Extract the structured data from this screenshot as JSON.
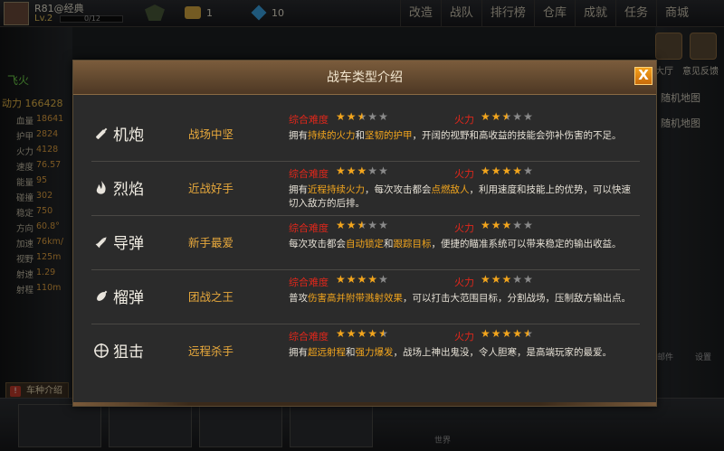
{
  "topbar": {
    "player_name": "R81@经典",
    "level": "Lv.2",
    "exp": "0/12",
    "gold": "1",
    "gems": "10",
    "menu": [
      "改造",
      "战队",
      "排行榜",
      "仓库",
      "成就",
      "任务",
      "商城"
    ]
  },
  "left_panel": {
    "car_name": "飞火",
    "power": "动力 166428",
    "stats": [
      {
        "name": "血量",
        "value": "18641"
      },
      {
        "name": "护甲",
        "value": "2824"
      },
      {
        "name": "火力",
        "value": "4128"
      },
      {
        "name": "速度",
        "value": "76.57"
      },
      {
        "name": "能量",
        "value": "95"
      },
      {
        "name": "碰撞",
        "value": "302"
      },
      {
        "name": "稳定",
        "value": "750"
      },
      {
        "name": "方向",
        "value": "60.8°"
      },
      {
        "name": "加速",
        "value": "76km/"
      },
      {
        "name": "视野",
        "value": "125m"
      },
      {
        "name": "射速",
        "value": "1.29"
      },
      {
        "name": "射程",
        "value": "110m"
      }
    ],
    "car_intro": "车种介绍"
  },
  "right_panel": {
    "lobby": "大厅",
    "feedback": "意见反馈",
    "map": "随机地图",
    "map2": "随机地图",
    "mail": "邮件",
    "settings": "设置"
  },
  "chat": {
    "world": "世界"
  },
  "dialog": {
    "title": "战车类型介绍",
    "close": "X",
    "difficulty_label": "综合难度",
    "firepower_label": "火力",
    "types": [
      {
        "icon": "machine-gun-icon",
        "name": "机炮",
        "tag": "战场中坚",
        "difficulty": 2.5,
        "firepower": 2.5,
        "desc": [
          {
            "t": "拥有",
            "h": false
          },
          {
            "t": "持续的火力",
            "h": true
          },
          {
            "t": "和",
            "h": false
          },
          {
            "t": "坚韧的护甲",
            "h": true
          },
          {
            "t": "，开阔的视野和高收益的技能会弥补伤害的不足。",
            "h": false
          }
        ]
      },
      {
        "icon": "flame-icon",
        "name": "烈焰",
        "tag": "近战好手",
        "difficulty": 3,
        "firepower": 4,
        "desc": [
          {
            "t": "拥有",
            "h": false
          },
          {
            "t": "近程持续火力",
            "h": true
          },
          {
            "t": "，每次攻击都会",
            "h": false
          },
          {
            "t": "点燃敌人",
            "h": true
          },
          {
            "t": "，利用速度和技能上的优势，可以快速切入敌方的后排。",
            "h": false
          }
        ]
      },
      {
        "icon": "missile-icon",
        "name": "导弹",
        "tag": "新手最爱",
        "difficulty": 2.5,
        "firepower": 3,
        "desc": [
          {
            "t": "每次攻击都会",
            "h": false
          },
          {
            "t": "自动锁定",
            "h": true
          },
          {
            "t": "和",
            "h": false
          },
          {
            "t": "跟踪目标",
            "h": true
          },
          {
            "t": "，便捷的瞄准系统可以带来稳定的输出收益。",
            "h": false
          }
        ]
      },
      {
        "icon": "grenade-icon",
        "name": "榴弹",
        "tag": "团战之王",
        "difficulty": 4,
        "firepower": 3,
        "desc": [
          {
            "t": "普攻",
            "h": false
          },
          {
            "t": "伤害高并附带溅射效果",
            "h": true
          },
          {
            "t": "，可以打击大范围目标，分割战场，压制敌方输出点。",
            "h": false
          }
        ]
      },
      {
        "icon": "crosshair-icon",
        "name": "狙击",
        "tag": "远程杀手",
        "difficulty": 4.5,
        "firepower": 4.5,
        "desc": [
          {
            "t": "拥有",
            "h": false
          },
          {
            "t": "超远射程",
            "h": true
          },
          {
            "t": "和",
            "h": false
          },
          {
            "t": "强力爆发",
            "h": true
          },
          {
            "t": "，战场上神出鬼没，令人胆寒，是高端玩家的最爱。",
            "h": false
          }
        ]
      }
    ]
  }
}
